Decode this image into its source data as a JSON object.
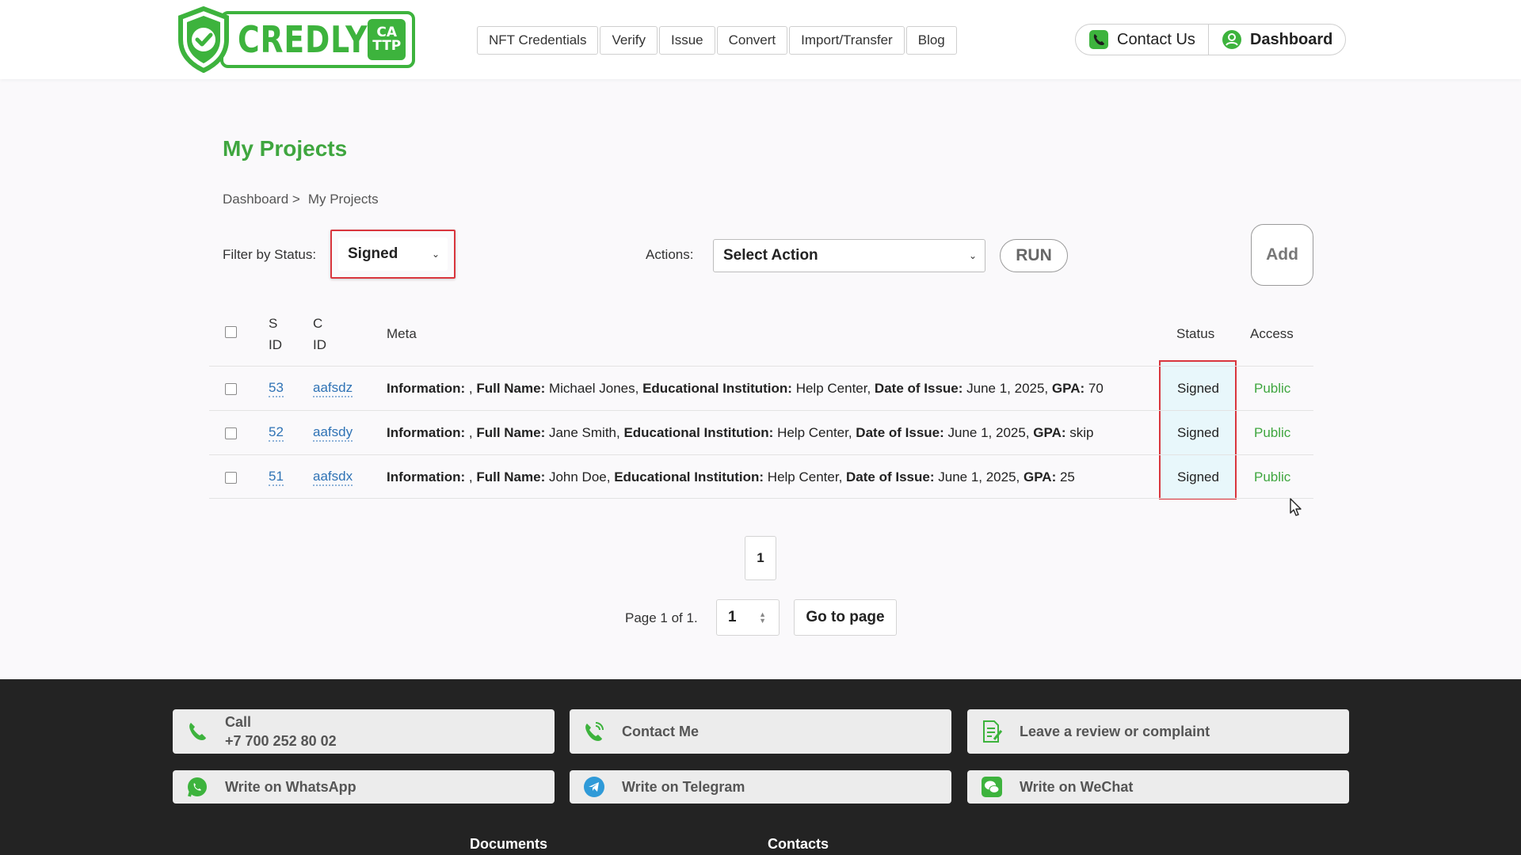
{
  "header": {
    "logo_text": "CREDLY",
    "logo_badge_top": "CA",
    "logo_badge_bottom": "TTP",
    "nav": [
      "NFT Credentials",
      "Verify",
      "Issue",
      "Convert",
      "Import/Transfer",
      "Blog"
    ],
    "contact_label": "Contact Us",
    "dashboard_label": "Dashboard"
  },
  "main": {
    "title": "My Projects",
    "breadcrumb": [
      "Dashboard >",
      "My Projects"
    ],
    "filter_label": "Filter by Status:",
    "filter_value": "Signed",
    "actions_label": "Actions:",
    "action_value": "Select Action",
    "run_label": "RUN",
    "add_label": "Add"
  },
  "table": {
    "headers": {
      "sid_line1": "S",
      "sid_line2": "ID",
      "cid_line1": "C",
      "cid_line2": "ID",
      "meta": "Meta",
      "status": "Status",
      "access": "Access"
    },
    "rows": [
      {
        "sid": "53",
        "cid": "aafsdz",
        "info_label": "Information:",
        "info_value": " , ",
        "name_label": "Full Name:",
        "name_value": " Michael Jones, ",
        "inst_label": "Educational Institution:",
        "inst_value": " Help Center, ",
        "date_label": "Date of Issue:",
        "date_value": " June 1, 2025, ",
        "gpa_label": "GPA:",
        "gpa_value": " 70",
        "status": "Signed",
        "access": "Public"
      },
      {
        "sid": "52",
        "cid": "aafsdy",
        "info_label": "Information:",
        "info_value": " , ",
        "name_label": "Full Name:",
        "name_value": " Jane Smith, ",
        "inst_label": "Educational Institution:",
        "inst_value": " Help Center, ",
        "date_label": "Date of Issue:",
        "date_value": " June 1, 2025, ",
        "gpa_label": "GPA:",
        "gpa_value": " skip",
        "status": "Signed",
        "access": "Public"
      },
      {
        "sid": "51",
        "cid": "aafsdx",
        "info_label": "Information:",
        "info_value": " , ",
        "name_label": "Full Name:",
        "name_value": " John Doe, ",
        "inst_label": "Educational Institution:",
        "inst_value": " Help Center, ",
        "date_label": "Date of Issue:",
        "date_value": " June 1, 2025, ",
        "gpa_label": "GPA:",
        "gpa_value": " 25",
        "status": "Signed",
        "access": "Public"
      }
    ]
  },
  "pagination": {
    "current_page": "1",
    "info": "Page 1 of 1.",
    "input_value": "1",
    "goto_label": "Go to page"
  },
  "footer": {
    "call_label": "Call",
    "call_number": "+7 700 252 80 02",
    "contact_me": "Contact Me",
    "review": "Leave a review or complaint",
    "whatsapp": "Write on WhatsApp",
    "telegram": "Write on Telegram",
    "wechat": "Write on WeChat",
    "documents_heading": "Documents",
    "contacts_heading": "Contacts"
  },
  "colors": {
    "brand_green": "#3db33d",
    "link_blue": "#2f73b5",
    "highlight_red": "#d9363e",
    "footer_bg": "#232323"
  }
}
